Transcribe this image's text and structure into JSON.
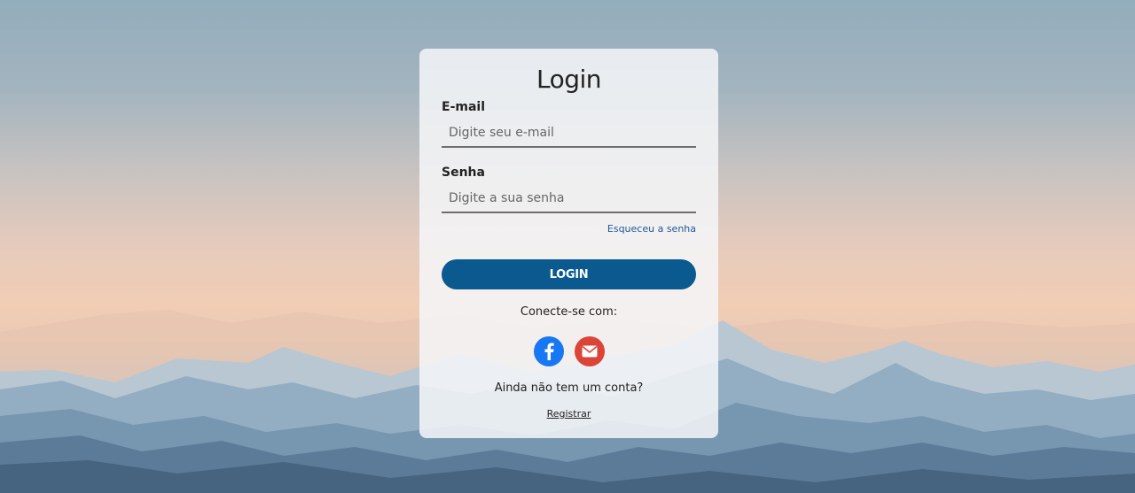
{
  "login": {
    "title": "Login",
    "email_label": "E-mail",
    "email_placeholder": "Digite seu e-mail",
    "email_value": "",
    "password_label": "Senha",
    "password_placeholder": "Digite a sua senha",
    "password_value": "",
    "forgot_label": "Esqueceu a senha",
    "login_button": "LOGIN",
    "connect_label": "Conecte-se com:",
    "social": [
      {
        "icon": "facebook-icon",
        "color": "#1877f2"
      },
      {
        "icon": "mail-icon",
        "color": "#db4437"
      }
    ],
    "no_account_text": "Ainda não tem um conta?",
    "register_label": "Registrar"
  },
  "colors": {
    "button": "#0a5a8f",
    "link": "#1d5a96"
  }
}
